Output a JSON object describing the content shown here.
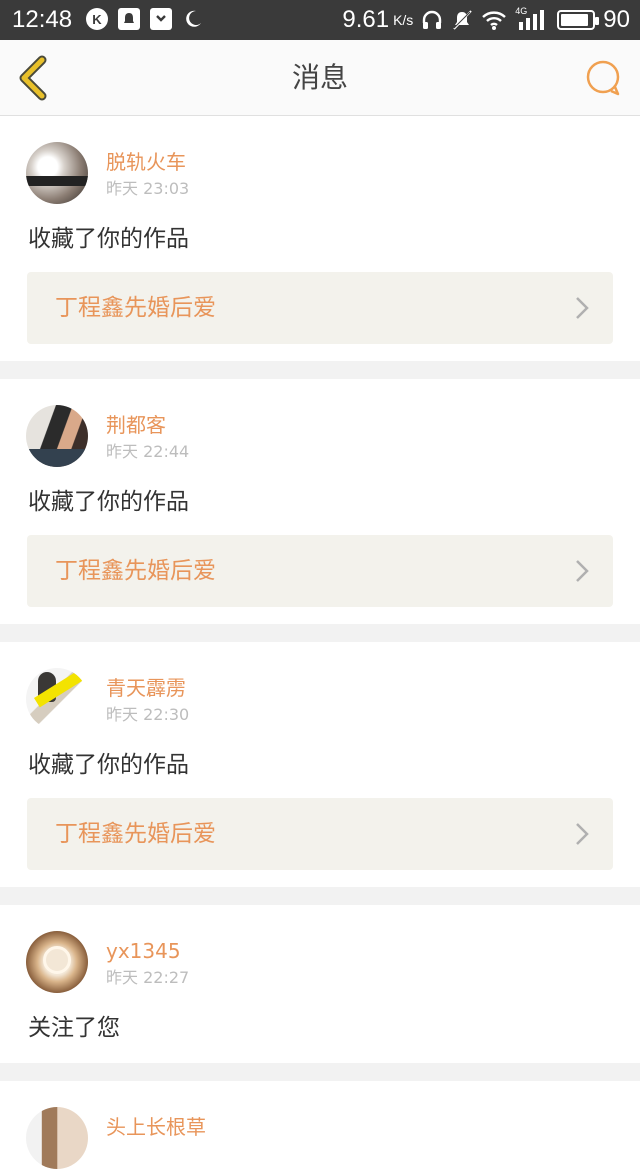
{
  "status_bar": {
    "time": "12:48",
    "left_icons": [
      "k-icon",
      "notification-icon",
      "pocket-icon",
      "moon-icon"
    ],
    "net_speed": "9.61",
    "net_speed_unit": "K/s",
    "network": "4G",
    "battery": "90",
    "battery_fraction": 0.9
  },
  "header": {
    "title": "消息",
    "accent": "#f0a050",
    "back_color": "#e8c02a"
  },
  "colors": {
    "name": "#e8955a",
    "time": "#bdbdbd",
    "link_bg": "#f3f2ec"
  },
  "messages": [
    {
      "user": "脱轨火车",
      "time": "昨天 23:03",
      "action": "收藏了你的作品",
      "work": "丁程鑫先婚后爱",
      "avatar": "avatar-photo-1"
    },
    {
      "user": "荆都客",
      "time": "昨天 22:44",
      "action": "收藏了你的作品",
      "work": "丁程鑫先婚后爱",
      "avatar": "avatar-photo-2"
    },
    {
      "user": "青天霹雳",
      "time": "昨天 22:30",
      "action": "收藏了你的作品",
      "work": "丁程鑫先婚后爱",
      "avatar": "avatar-photo-3"
    },
    {
      "user": "yx1345",
      "time": "昨天 22:27",
      "action": "关注了您",
      "avatar": "avatar-photo-4"
    },
    {
      "user": "头上长根草",
      "avatar": "avatar-photo-5"
    }
  ]
}
